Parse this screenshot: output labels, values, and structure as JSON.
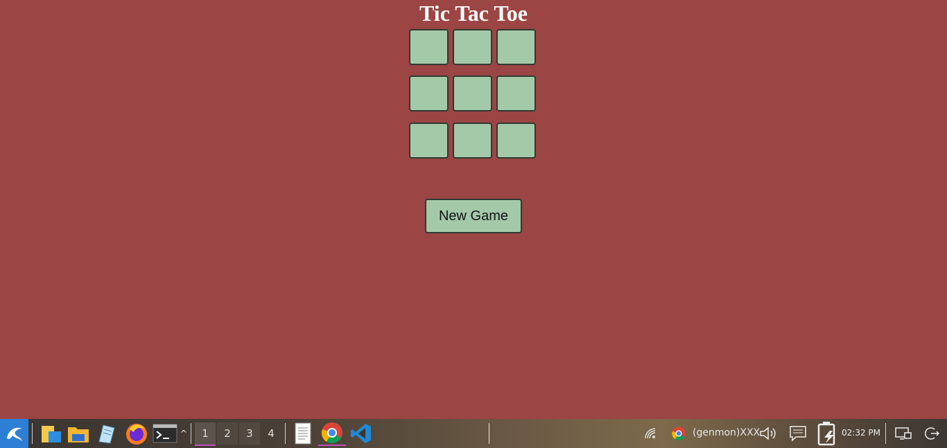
{
  "game": {
    "title": "Tic Tac Toe",
    "cells": [
      "",
      "",
      "",
      "",
      "",
      "",
      "",
      "",
      ""
    ],
    "new_game_label": "New Game"
  },
  "taskbar": {
    "workspaces": [
      "1",
      "2",
      "3",
      "4"
    ],
    "genmon_label": "(genmon)XXX",
    "clock": "02:32 PM",
    "icons": [
      "kali-start-icon",
      "files-icon",
      "folder-icon",
      "text-editor-icon",
      "firefox-icon",
      "terminal-icon",
      "document-icon",
      "chrome-icon",
      "vscode-icon",
      "network-icon",
      "volume-icon",
      "notifications-icon",
      "battery-icon",
      "display-icon",
      "logout-icon"
    ]
  },
  "colors": {
    "page_background": "#9b4544",
    "cell_background": "#a4c9a9",
    "title_color": "#ffffff"
  }
}
